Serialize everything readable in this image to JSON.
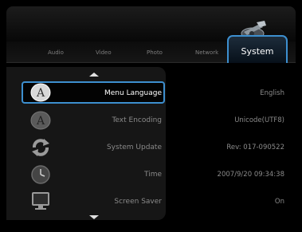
{
  "tabs": [
    "Audio",
    "Video",
    "Photo",
    "Network"
  ],
  "active_tab": "System",
  "settings": [
    {
      "label": "Menu Language",
      "value": "English",
      "icon": "a-letter-icon",
      "selected": true
    },
    {
      "label": "Text Encoding",
      "value": "Unicode(UTF8)",
      "icon": "a-letter-icon",
      "selected": false
    },
    {
      "label": "System Update",
      "value": "Rev: 017-090522",
      "icon": "refresh-arrows-icon",
      "selected": false
    },
    {
      "label": "Time",
      "value": "2007/9/20 09:34:38",
      "icon": "clock-icon",
      "selected": false
    },
    {
      "label": "Screen Saver",
      "value": "On",
      "icon": "monitor-icon",
      "selected": false
    }
  ],
  "colors": {
    "accent": "#3d8fcf",
    "text_dim": "#8a8a8a",
    "text_active": "#ffffff"
  }
}
